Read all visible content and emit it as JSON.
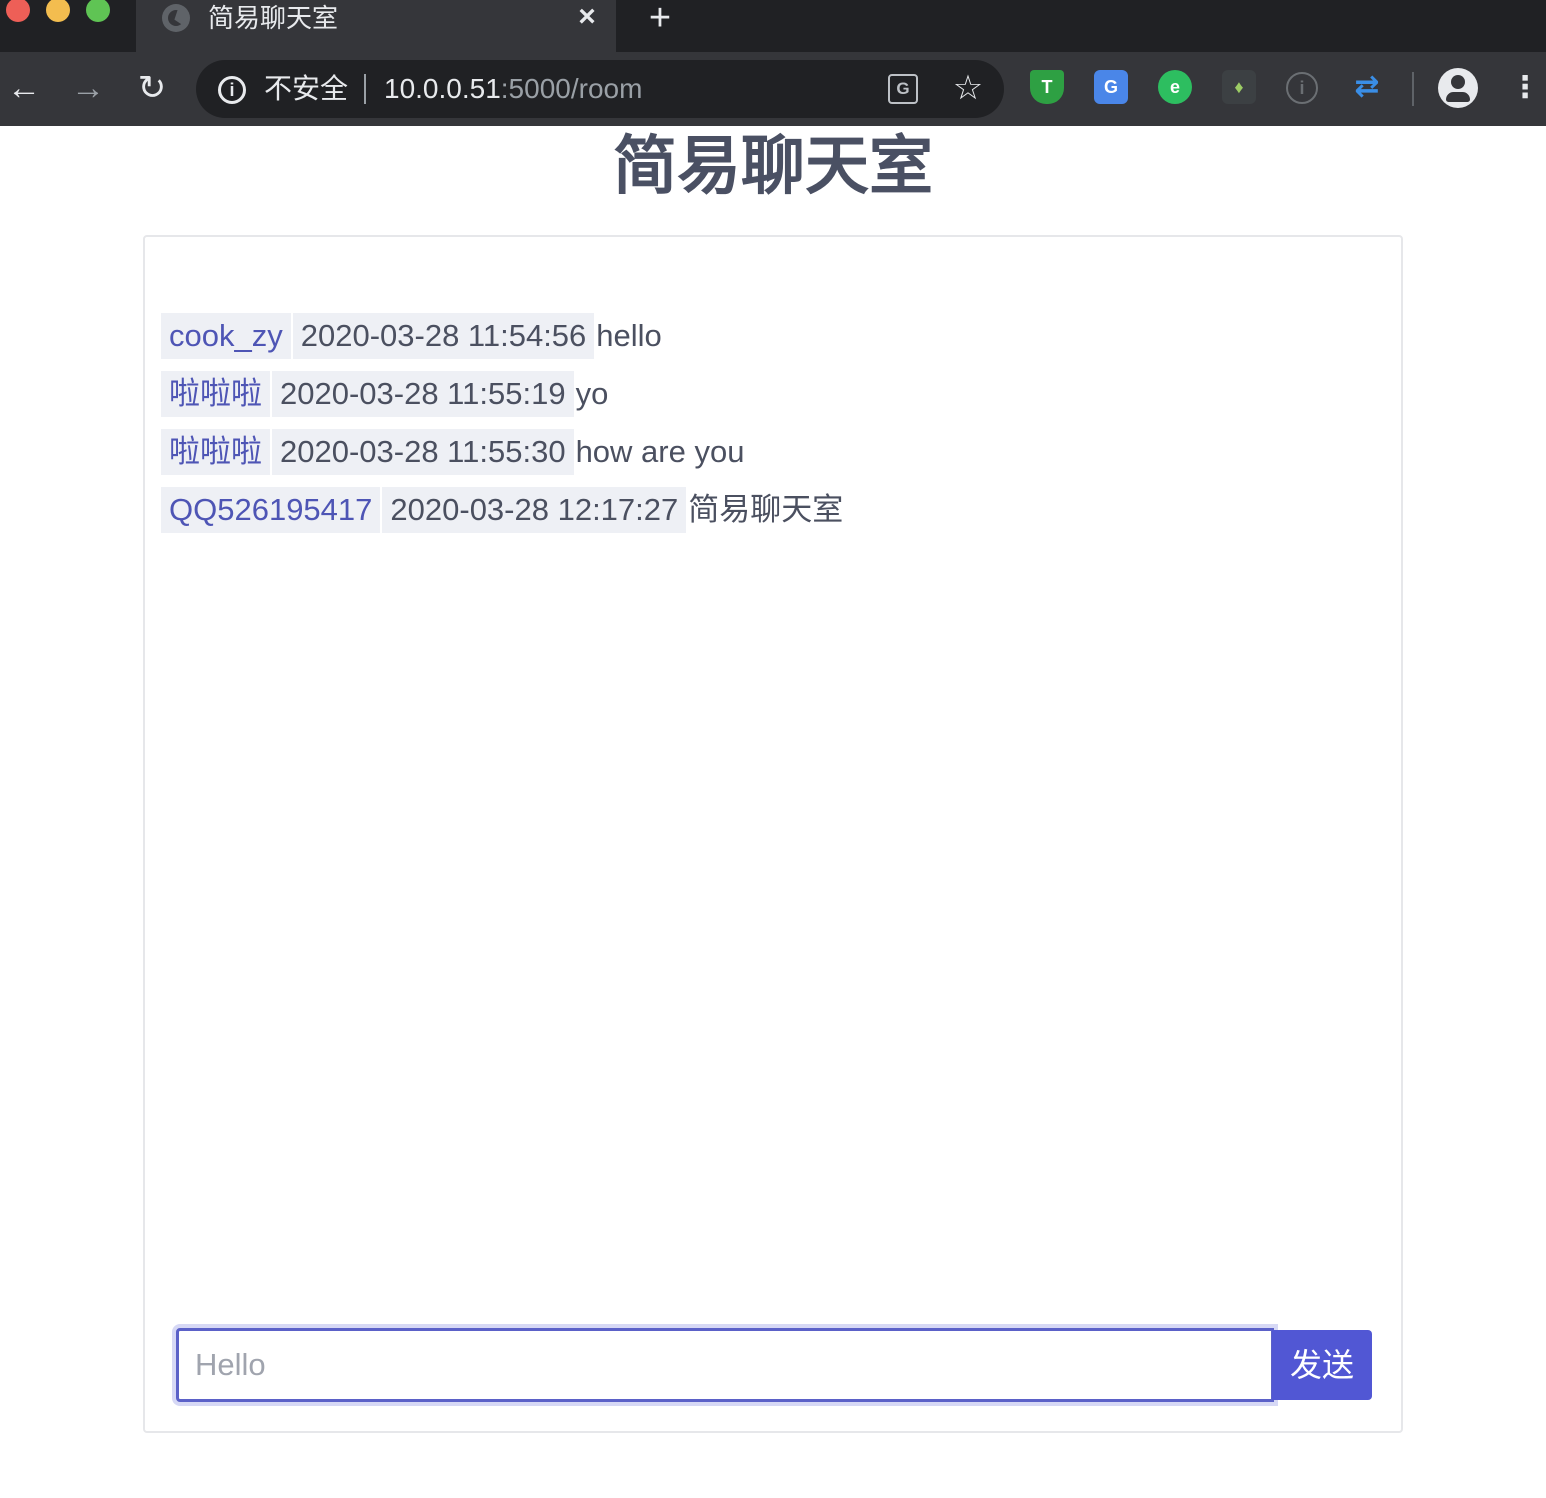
{
  "browser": {
    "tab_title": "简易聊天室",
    "tab_close": "×",
    "new_tab": "+",
    "security_label": "不安全",
    "url_host": "10.0.0.51",
    "url_path": ":5000/room",
    "icons": {
      "back": "←",
      "forward": "→",
      "reload": "↻",
      "info": "i",
      "translate": "G",
      "star": "☆",
      "menu": "⋮"
    },
    "extensions": [
      {
        "name": "shield-extension",
        "glyph": "T"
      },
      {
        "name": "google-translate-extension",
        "glyph": "G"
      },
      {
        "name": "evernote-extension",
        "glyph": "e"
      },
      {
        "name": "key-extension",
        "glyph": "♦"
      },
      {
        "name": "info-extension",
        "glyph": "i"
      },
      {
        "name": "sync-extension",
        "glyph": "⇄"
      }
    ]
  },
  "page": {
    "title": "简易聊天室"
  },
  "messages": [
    {
      "user": "cook_zy",
      "time": "2020-03-28 11:54:56",
      "text": "hello"
    },
    {
      "user": "啦啦啦",
      "time": "2020-03-28 11:55:19",
      "text": "yo"
    },
    {
      "user": "啦啦啦",
      "time": "2020-03-28 11:55:30",
      "text": "how are you"
    },
    {
      "user": "QQ526195417",
      "time": "2020-03-28 12:17:27",
      "text": "简易聊天室"
    }
  ],
  "composer": {
    "value": "",
    "placeholder": "Hello",
    "send_label": "发送"
  },
  "colors": {
    "accent": "#5157d4",
    "username": "#4e55b5",
    "title": "#4a5063"
  }
}
